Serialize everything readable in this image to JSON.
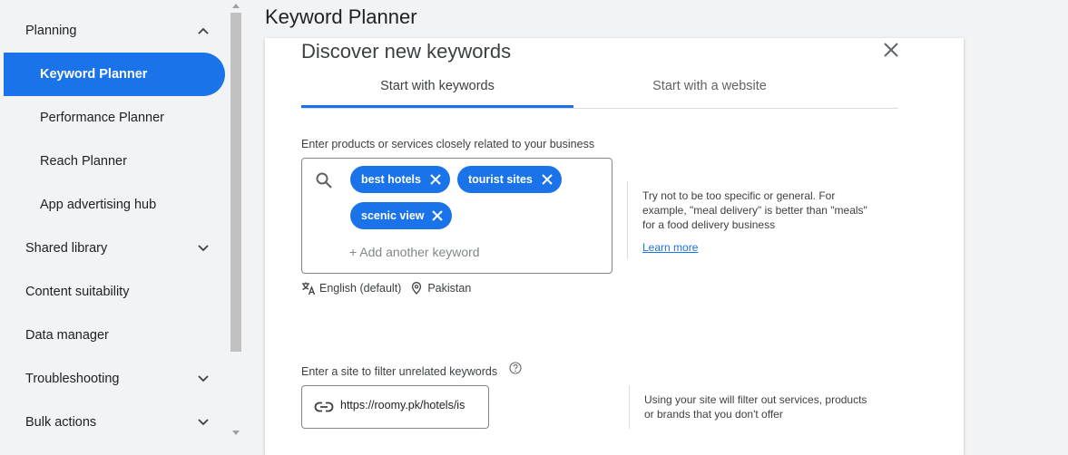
{
  "sidebar": {
    "items": [
      {
        "label": "Planning",
        "type": "top",
        "chevron": "up"
      },
      {
        "label": "Keyword Planner",
        "type": "sub",
        "active": true
      },
      {
        "label": "Performance Planner",
        "type": "sub"
      },
      {
        "label": "Reach Planner",
        "type": "sub"
      },
      {
        "label": "App advertising hub",
        "type": "sub"
      },
      {
        "label": "Shared library",
        "type": "top",
        "chevron": "down"
      },
      {
        "label": "Content suitability",
        "type": "top"
      },
      {
        "label": "Data manager",
        "type": "top"
      },
      {
        "label": "Troubleshooting",
        "type": "top",
        "chevron": "down"
      },
      {
        "label": "Bulk actions",
        "type": "top",
        "chevron": "down"
      }
    ]
  },
  "page": {
    "title": "Keyword Planner"
  },
  "dialog": {
    "title": "Discover new keywords",
    "tabs": [
      {
        "label": "Start with keywords",
        "selected": true
      },
      {
        "label": "Start with a website",
        "selected": false
      }
    ],
    "keywords": {
      "label": "Enter products or services closely related to your business",
      "chips": [
        "best hotels",
        "tourist sites",
        "scenic view"
      ],
      "add_placeholder": "+ Add another keyword",
      "language": "English (default)",
      "location": "Pakistan",
      "hint": "Try not to be too specific or general. For example, \"meal delivery\" is better than \"meals\" for a food delivery business",
      "learn_more": "Learn more"
    },
    "site": {
      "label": "Enter a site to filter unrelated keywords",
      "value": "https://roomy.pk/hotels/is",
      "hint": "Using your site will filter out services, products or brands that you don't offer"
    }
  },
  "colors": {
    "accent": "#1a73e8",
    "sidebar_bg": "#f1f3f4"
  }
}
